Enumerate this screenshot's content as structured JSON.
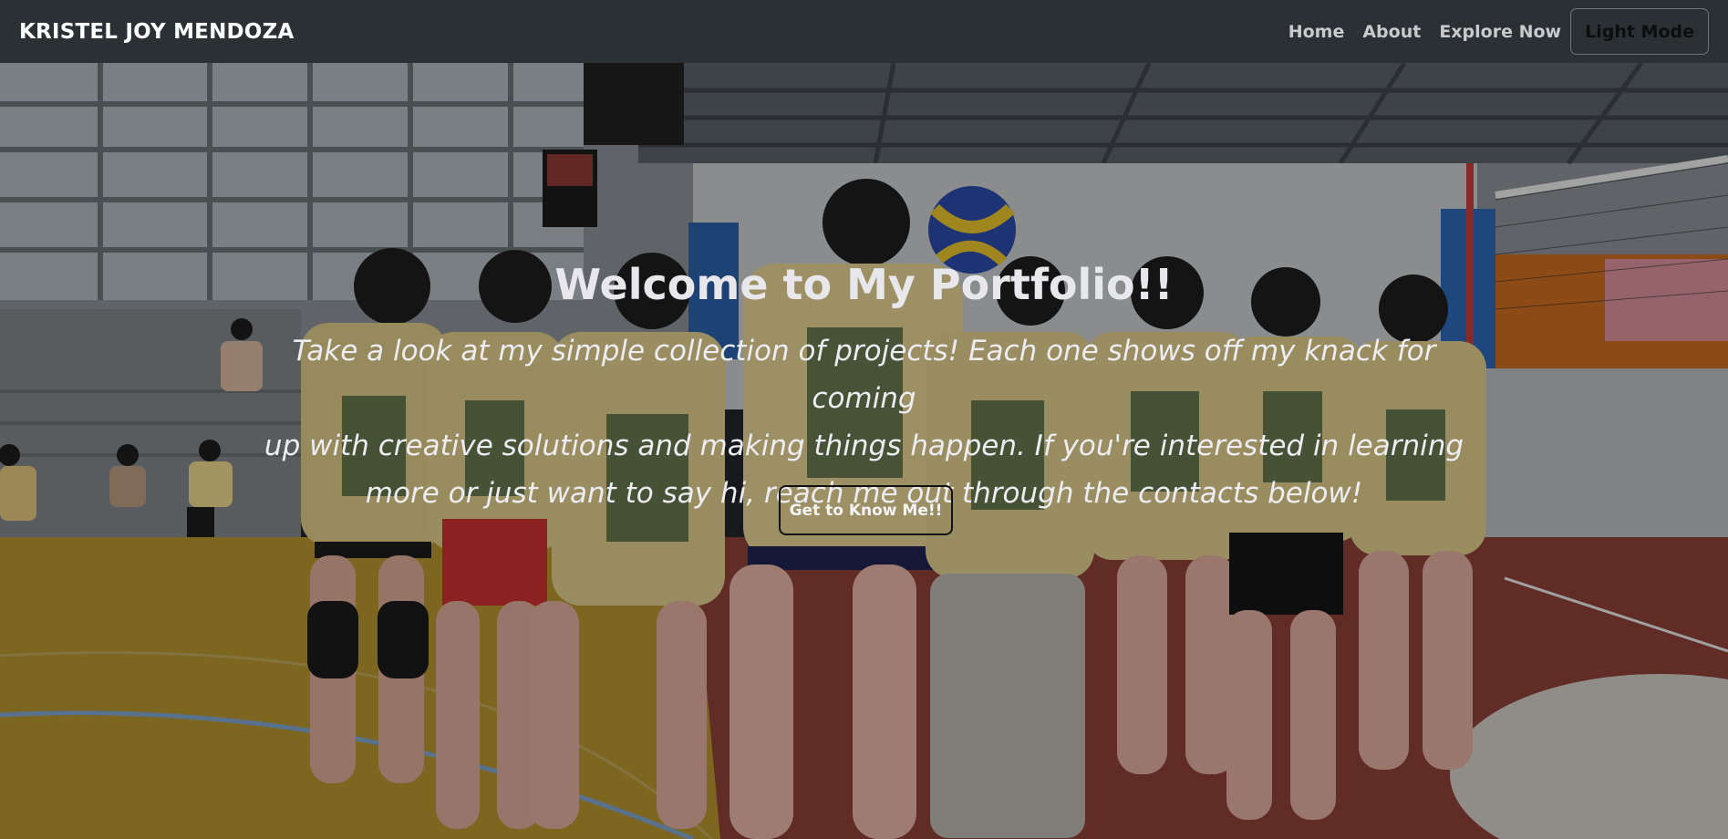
{
  "navbar": {
    "brand": "KRISTEL JOY MENDOZA",
    "links": [
      "Home",
      "About",
      "Explore Now"
    ],
    "mode_button": "Light Mode"
  },
  "hero": {
    "title": "Welcome to My Portfolio!!",
    "subtitle_lines": [
      "Take a look at my simple collection of projects! Each one shows off my knack for coming",
      "up with creative solutions and making things happen. If you're interested in learning",
      "more or just want to say hi, reach me out through the contacts below!"
    ],
    "cta_label": "Get to Know Me!!",
    "background_image": "photo of volleyball team in yellow jerseys standing on an indoor court, backs to camera"
  },
  "colors": {
    "navbar_bg": "#2b3035",
    "brand_text": "#ffffff",
    "nav_link_text": "#c8cacc",
    "hero_text": "#e7e7ec"
  }
}
